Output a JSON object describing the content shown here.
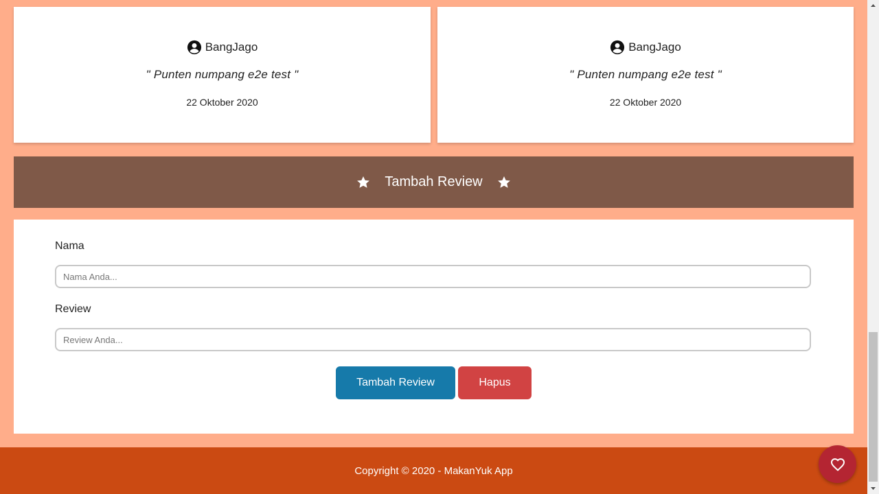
{
  "reviews": [
    {
      "name": "BangJago",
      "quote_open": "\"",
      "text": "Punten numpang e2e test",
      "quote_close": "\"",
      "date": "22 Oktober 2020"
    },
    {
      "name": "BangJago",
      "quote_open": "\"",
      "text": "Punten numpang e2e test",
      "quote_close": "\"",
      "date": "22 Oktober 2020"
    }
  ],
  "add_review": {
    "title": "Tambah Review",
    "name_label": "Nama",
    "name_placeholder": "Nama Anda...",
    "name_value": "",
    "review_label": "Review",
    "review_placeholder": "Review Anda...",
    "review_value": "",
    "submit_label": "Tambah Review",
    "delete_label": "Hapus"
  },
  "footer": {
    "copyright": "Copyright © 2020 - MakanYuk App"
  },
  "icons": {
    "reviewer": "account-circle-icon",
    "header_stars": "star-icon",
    "fab": "heart-outline-icon"
  },
  "colors": {
    "page_bg": "#ffad8a",
    "header_bg": "#7f5948",
    "submit_button": "#167aaa",
    "delete_button": "#d14343",
    "footer_bg": "#cb4a12",
    "fab_bg": "#b42532"
  }
}
